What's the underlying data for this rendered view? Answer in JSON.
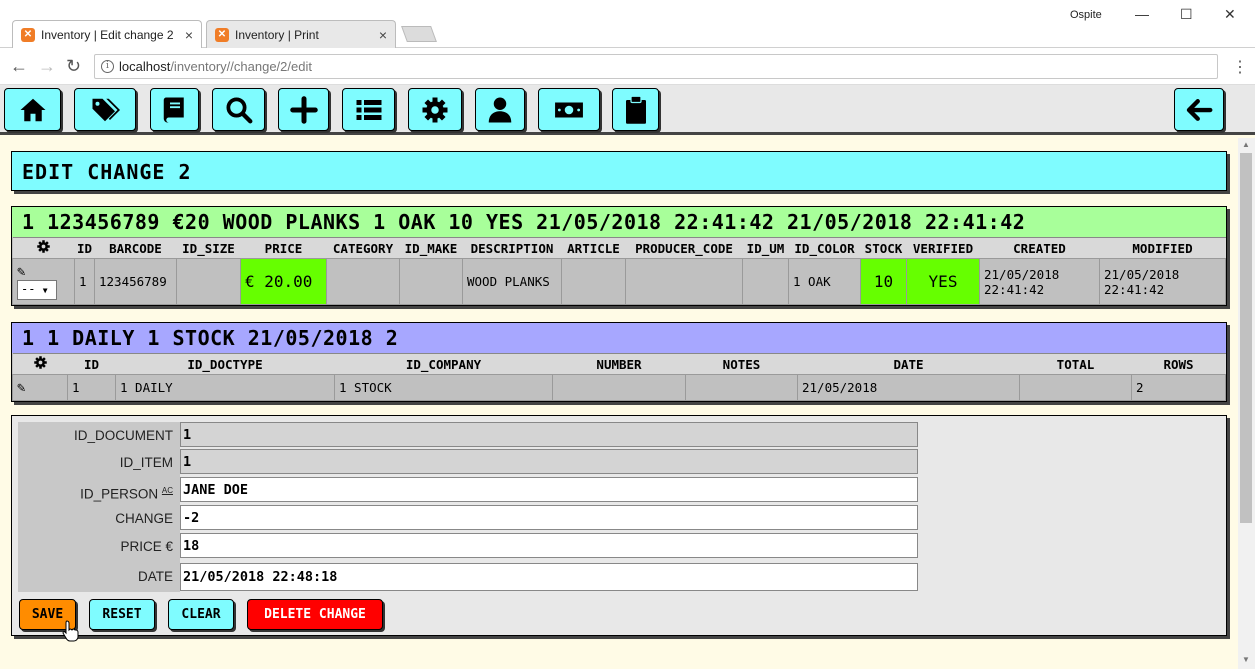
{
  "browser": {
    "tabs": [
      {
        "title": "Inventory | Edit change 2",
        "active": true
      },
      {
        "title": "Inventory | Print",
        "active": false
      }
    ],
    "profile": "Ospite",
    "url_host": "localhost",
    "url_path": "/inventory//change/2/edit"
  },
  "toolbar": {
    "buttons": [
      "home-icon",
      "tags-icon",
      "book-icon",
      "search-icon",
      "plus-icon",
      "list-icon",
      "gear-icon",
      "user-icon",
      "money-icon",
      "clipboard-icon",
      "arrow-left-icon"
    ]
  },
  "title": "EDIT CHANGE 2",
  "item": {
    "header": "1 123456789 €20 WOOD PLANKS 1 OAK 10 YES 21/05/2018 22:41:42 21/05/2018 22:41:42",
    "header_color": "#a8ff9a",
    "columns": [
      "ID",
      "BARCODE",
      "ID_SIZE",
      "PRICE",
      "CATEGORY",
      "ID_MAKE",
      "DESCRIPTION",
      "ARTICLE",
      "PRODUCER_CODE",
      "ID_UM",
      "ID_COLOR",
      "STOCK",
      "VERIFIED",
      "CREATED",
      "MODIFIED"
    ],
    "row": {
      "select": "--",
      "id": "1",
      "barcode": "123456789",
      "id_size": "",
      "price": "€ 20.00",
      "category": "",
      "id_make": "",
      "description": "WOOD PLANKS",
      "article": "",
      "producer_code": "",
      "id_um": "",
      "id_color": "1 OAK",
      "stock": "10",
      "verified": "YES",
      "created": "21/05/2018 22:41:42",
      "modified": "21/05/2018 22:41:42"
    }
  },
  "document": {
    "header": "1 1 DAILY 1 STOCK 21/05/2018 2",
    "header_color": "#a7a7ff",
    "columns": [
      "ID",
      "ID_DOCTYPE",
      "ID_COMPANY",
      "NUMBER",
      "NOTES",
      "DATE",
      "TOTAL",
      "ROWS"
    ],
    "row": {
      "id": "1",
      "id_doctype": "1 DAILY",
      "id_company": "1 STOCK",
      "number": "",
      "notes": "",
      "date": "21/05/2018",
      "total": "",
      "rows": "2"
    }
  },
  "form": {
    "fields": [
      {
        "label": "ID_DOCUMENT",
        "value": "1",
        "readonly": true
      },
      {
        "label": "ID_ITEM",
        "value": "1",
        "readonly": true
      },
      {
        "label": "ID_PERSON",
        "sup": "AC",
        "value": "JANE DOE",
        "readonly": false
      },
      {
        "label": "CHANGE",
        "value": "-2",
        "readonly": false
      },
      {
        "label": "PRICE €",
        "value": "18",
        "readonly": false
      },
      {
        "label": "DATE",
        "value": "21/05/2018 22:48:18",
        "readonly": false
      }
    ],
    "buttons": {
      "save": "SAVE",
      "reset": "RESET",
      "clear": "CLEAR",
      "delete": "DELETE CHANGE"
    },
    "colors": {
      "save": "#ff8c00",
      "reset": "#7ffcff",
      "delete": "#ff0000"
    }
  }
}
